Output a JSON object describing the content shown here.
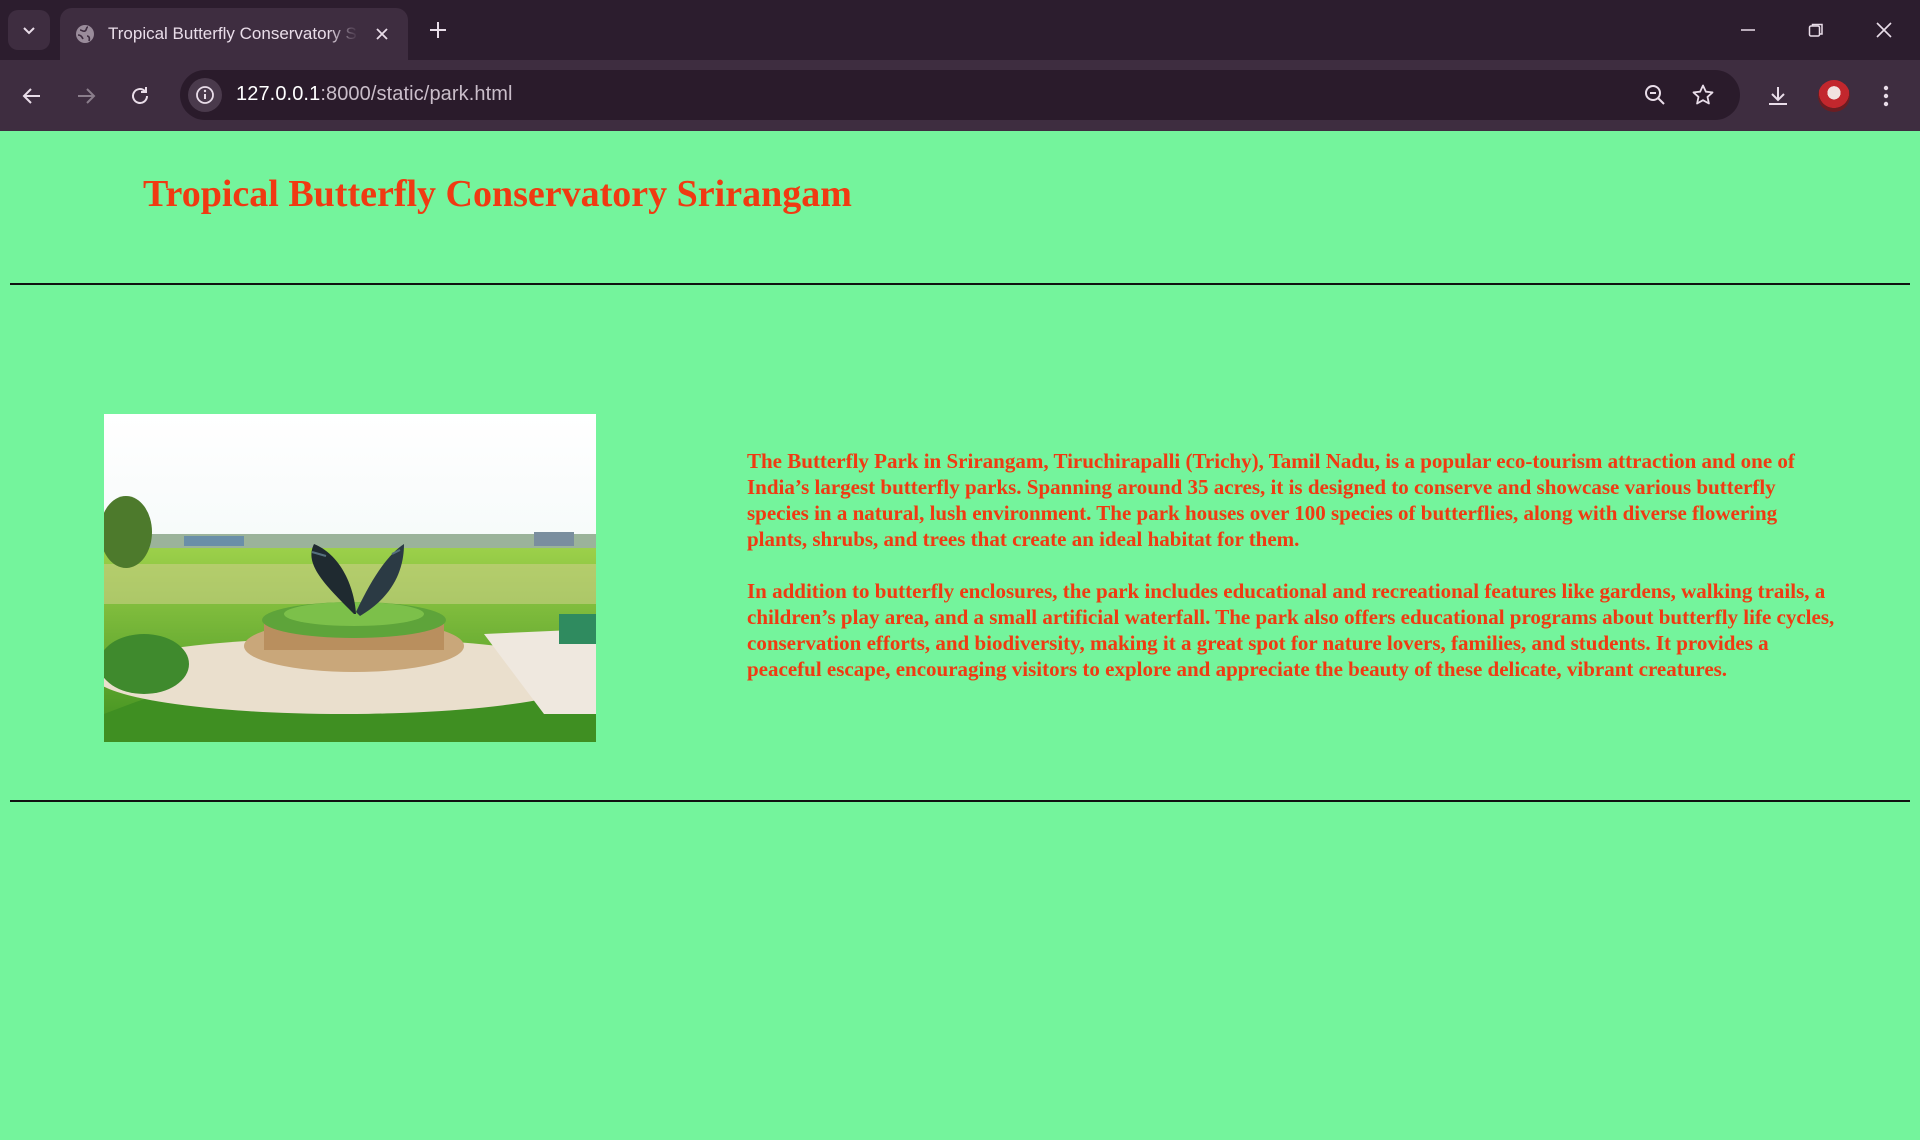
{
  "browser": {
    "tab_title": "Tropical Butterfly Conservatory Srirangam",
    "url_host": "127.0.0.1",
    "url_path": ":8000/static/park.html",
    "icons": [
      "tab-search-icon",
      "globe-icon",
      "close-icon",
      "plus-icon",
      "minimize-icon",
      "restore-icon",
      "window-close-icon",
      "back-icon",
      "forward-icon",
      "reload-icon",
      "info-icon",
      "zoom-icon",
      "star-icon",
      "download-icon",
      "more-vert-icon"
    ]
  },
  "page": {
    "title": "Tropical Butterfly Conservatory Srirangam",
    "paragraphs": [
      "The Butterfly Park in Srirangam, Tiruchirapalli (Trichy), Tamil Nadu, is a popular eco-tourism attraction and one of India’s largest butterfly parks. Spanning around 35 acres, it is designed to conserve and showcase various butterfly species in a natural, lush environment. The park houses over 100 species of butterflies, along with diverse flowering plants, shrubs, and trees that create an ideal habitat for them.",
      "In addition to butterfly enclosures, the park includes educational and recreational features like gardens, walking trails, a children’s play area, and a small artificial waterfall. The park also offers educational programs about butterfly life cycles, conservation efforts, and biodiversity, making it a great spot for nature lovers, families, and students. It provides a peaceful escape, encouraging visitors to explore and appreciate the beauty of these delicate, vibrant creatures."
    ]
  },
  "colors": {
    "page_background": "#74f49c",
    "text_accent": "#f03a12",
    "chrome_dark": "#2c1d2e",
    "chrome_toolbar": "#3e2d40"
  }
}
